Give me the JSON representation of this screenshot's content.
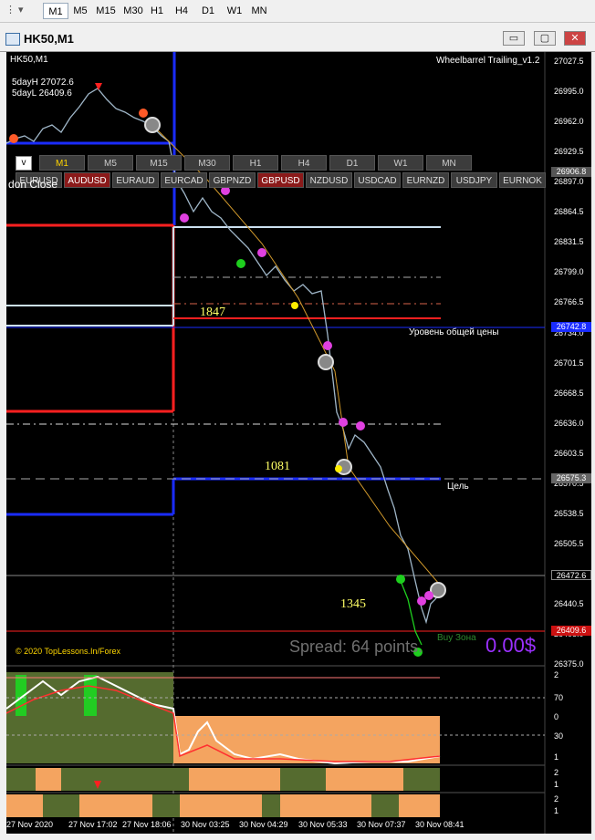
{
  "toolbar": {
    "grip": "⋮ ▾",
    "timeframes": [
      "M1",
      "M5",
      "M15",
      "M30",
      "H1",
      "H4",
      "D1",
      "W1",
      "MN"
    ],
    "active": "M1"
  },
  "window": {
    "title": "HK50,M1",
    "minimize": "▭",
    "restore": "▢",
    "close": "✕"
  },
  "chart": {
    "symbol_label": "HK50,M1",
    "indicator_name": "Wheelbarrel Trailing_v1.2",
    "day_high": "5dayH 27072.6",
    "day_low": "5dayL 26409.6",
    "checkbox_label": "v",
    "tf_buttons": [
      "M1",
      "M5",
      "M15",
      "M30",
      "H1",
      "H4",
      "D1",
      "W1",
      "MN"
    ],
    "tf_active": "M1",
    "symbols": [
      "EURUSD",
      "AUDUSD",
      "EURAUD",
      "EURCAD",
      "GBPNZD",
      "GBPUSD",
      "NZDUSD",
      "USDCAD",
      "EURNZD",
      "USDJPY",
      "EURNOK"
    ],
    "symbols_on": [
      "AUDUSD",
      "GBPUSD"
    ],
    "don_close": "don Close",
    "level_1847": "1847",
    "level_1081": "1081",
    "level_1345": "1345",
    "general_price_level": "Уровень общей цены",
    "target": "Цель",
    "buy_zone": "Buy Зона",
    "spread": "Spread: 64 points.",
    "profit": "0.00$",
    "copyright": "© 2020 TopLessons.In/Forex",
    "price_labels": [
      "27027.5",
      "26995.0",
      "26962.0",
      "26929.5",
      "26897.0",
      "26864.5",
      "26831.5",
      "26799.0",
      "26766.5",
      "26734.0",
      "26701.5",
      "26668.5",
      "26636.0",
      "26603.5",
      "26570.5",
      "26538.5",
      "26505.5",
      "26440.5",
      "26408.0",
      "26375.0"
    ],
    "price_badges": {
      "current": "26906.8",
      "level_blue": "26742.8",
      "level_grey": "26575.3",
      "last": "26472.6",
      "low": "26409.6"
    },
    "sub1_scale": [
      "2",
      "70",
      "0",
      "30",
      "1"
    ],
    "sub2_scale": [
      "2",
      "1"
    ],
    "sub3_scale": [
      "2",
      "1"
    ],
    "time_labels": [
      "27 Nov 2020",
      "27 Nov 17:02",
      "27 Nov 18:06",
      "30 Nov 03:25",
      "30 Nov 04:29",
      "30 Nov 05:33",
      "30 Nov 07:37",
      "30 Nov 08:41"
    ],
    "colors": {
      "background": "#000000",
      "price_line": "#9fb6c8",
      "red_level": "#ff2020",
      "blue_level": "#1a2cff",
      "buy_zone": "#2e8b2e",
      "profit": "#9b30ff",
      "spread": "#707070",
      "orange_hist": "#f4a460",
      "olive_hist": "#556b2f",
      "green_hist": "#22cc22"
    }
  }
}
